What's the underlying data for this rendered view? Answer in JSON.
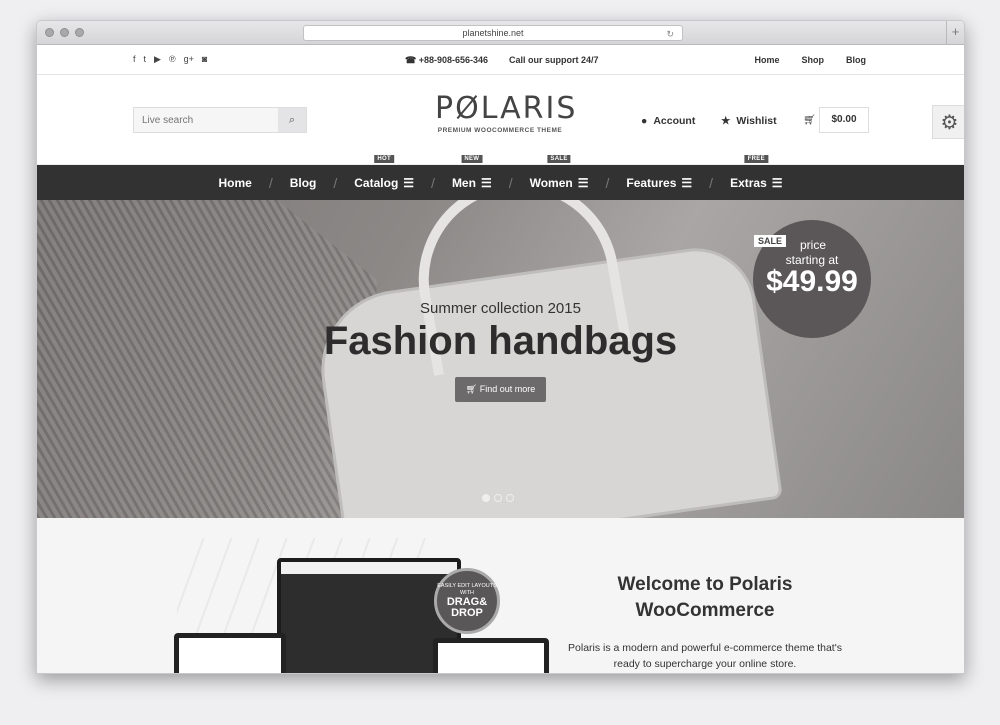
{
  "browser": {
    "url": "planetshine.net"
  },
  "topbar": {
    "social": [
      "f",
      "t",
      "yt",
      "p",
      "g+",
      "ig"
    ],
    "phone": "+88-908-656-346",
    "support": "Call our support 24/7",
    "links": [
      "Home",
      "Shop",
      "Blog"
    ]
  },
  "header": {
    "search_placeholder": "Live search",
    "logo": "PØLARIS",
    "tagline": "PREMIUM WOOCOMMERCE THEME",
    "account": "Account",
    "wishlist": "Wishlist",
    "cart_total": "$0.00"
  },
  "nav": {
    "items": [
      {
        "label": "Home",
        "badge": ""
      },
      {
        "label": "Blog",
        "badge": ""
      },
      {
        "label": "Catalog",
        "badge": "HOT"
      },
      {
        "label": "Men",
        "badge": "NEW"
      },
      {
        "label": "Women",
        "badge": "SALE"
      },
      {
        "label": "Features",
        "badge": ""
      },
      {
        "label": "Extras",
        "badge": "FREE"
      }
    ]
  },
  "hero": {
    "subtitle": "Summer collection 2015",
    "title": "Fashion handbags",
    "button": "Find out more",
    "sale": "SALE",
    "price_line1": "price",
    "price_line2": "starting at",
    "price": "$49.99"
  },
  "welcome": {
    "title": "Welcome to Polaris WooCommerce",
    "text": "Polaris is a modern and powerful e-commerce theme that's ready to supercharge your online store.",
    "seal": "EASILY EDIT LAYOUTS WITH",
    "seal_big": "DRAG& DROP"
  }
}
